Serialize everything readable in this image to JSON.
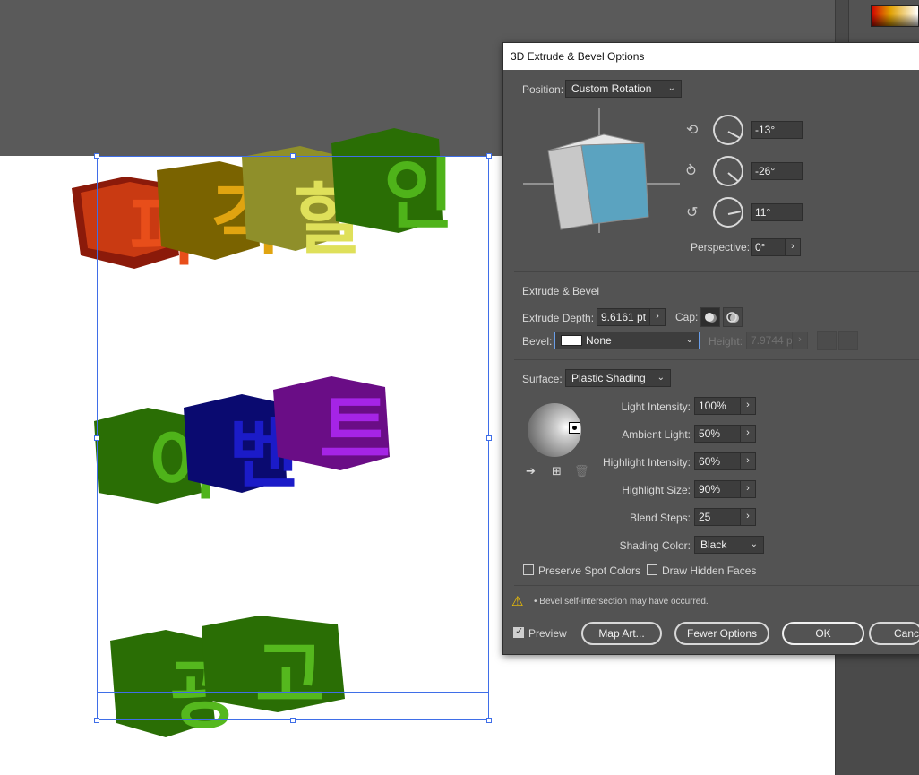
{
  "dialog": {
    "title": "3D Extrude & Bevel Options",
    "position_label": "Position:",
    "position_value": "Custom Rotation",
    "rot_x": "-13°",
    "rot_y": "-26°",
    "rot_z": "11°",
    "perspective_label": "Perspective:",
    "perspective_value": "0°",
    "extrude_section": "Extrude & Bevel",
    "extrude_depth_label": "Extrude Depth:",
    "extrude_depth_value": "9.6161 pt",
    "cap_label": "Cap:",
    "bevel_label": "Bevel:",
    "bevel_value": "None",
    "height_label": "Height:",
    "height_value": "7.9744 p",
    "surface_label": "Surface:",
    "surface_value": "Plastic Shading",
    "light_intensity_label": "Light Intensity:",
    "light_intensity_value": "100%",
    "ambient_light_label": "Ambient Light:",
    "ambient_light_value": "50%",
    "highlight_intensity_label": "Highlight Intensity:",
    "highlight_intensity_value": "60%",
    "highlight_size_label": "Highlight Size:",
    "highlight_size_value": "90%",
    "blend_steps_label": "Blend Steps:",
    "blend_steps_value": "25",
    "shading_color_label": "Shading Color:",
    "shading_color_value": "Black",
    "preserve_spot_label": "Preserve Spot Colors",
    "draw_hidden_label": "Draw Hidden Faces",
    "warning_text": "• Bevel self-intersection may have occurred.",
    "preview_label": "Preview",
    "map_art_label": "Map Art...",
    "fewer_options_label": "Fewer Options",
    "ok_label": "OK",
    "cancel_label": "Cance"
  },
  "artwork": {
    "line1": [
      "파",
      "격",
      "할",
      "인"
    ],
    "line2": [
      "이",
      "벤",
      "트"
    ],
    "line3": [
      "광",
      "고"
    ]
  },
  "colors": {
    "cube_front": "#5ba3c0",
    "cube_side": "#c8c8c8",
    "cube_top": "#e6e6e6",
    "selection": "#3f6ee8"
  }
}
